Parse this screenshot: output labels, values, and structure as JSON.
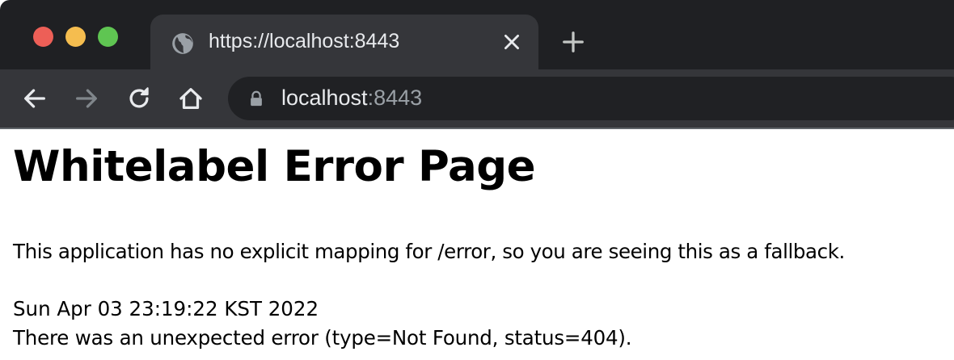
{
  "browser": {
    "tab": {
      "title": "https://localhost:8443",
      "icon": "globe-icon"
    },
    "toolbar": {
      "icons": [
        "back-arrow-icon",
        "forward-arrow-icon",
        "reload-icon",
        "home-icon"
      ]
    },
    "omnibox": {
      "host": "localhost",
      "port": ":8443",
      "icon": "lock-icon"
    },
    "colors": {
      "tabstrip": "#1f2023",
      "active_tab": "#35363a",
      "omnibox": "#202124",
      "traffic_close": "#ed5f57",
      "traffic_minimize": "#f5bd4f",
      "traffic_maximize": "#5fc552"
    }
  },
  "page": {
    "heading": "Whitelabel Error Page",
    "explanation": "This application has no explicit mapping for /error, so you are seeing this as a fallback.",
    "timestamp": "Sun Apr 03 23:19:22 KST 2022",
    "error": "There was an unexpected error (type=Not Found, status=404)."
  }
}
